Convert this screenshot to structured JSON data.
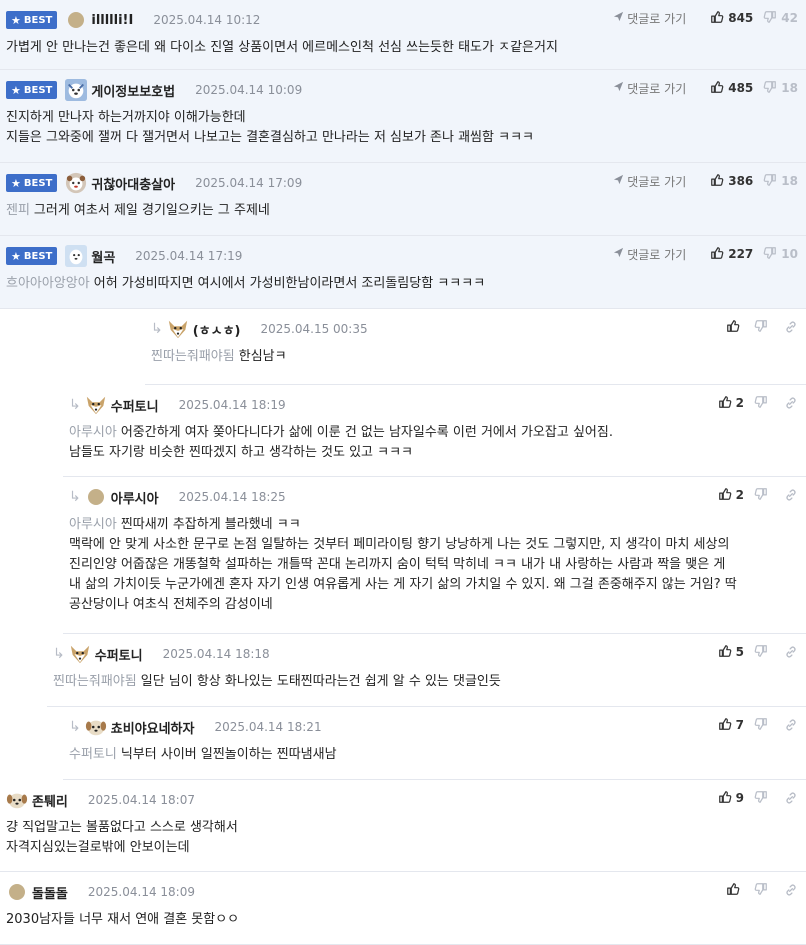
{
  "labels": {
    "best": "BEST",
    "reply_to": "댓글로 가기"
  },
  "colors": {
    "best_badge": "#3d6ec9",
    "best_bg": "#f1f5fb",
    "divider": "#e4e7ee",
    "muted": "#8a8f99"
  },
  "comments": [
    {
      "best": true,
      "avatar": "brown-circle",
      "author": "illllli!I",
      "date": "2025.04.14 10:12",
      "likes": "845",
      "dislikes": "42",
      "lines": [
        "가볍게 안 만나는건 좋은데 왜 다이소 진열 상품이면서 에르메스인척 선심 쓰는듯한 태도가 ㅈ같은거지"
      ]
    },
    {
      "best": true,
      "avatar": "blue-dog",
      "author": "게이정보보호법",
      "date": "2025.04.14 10:09",
      "likes": "485",
      "dislikes": "18",
      "lines": [
        "진지하게 만나자 하는거까지야 이해가능한데",
        "지들은 그와중에 잴꺼 다 잴거면서 나보고는 결혼결심하고 만나라는 저 심보가 존나 괘씸함 ㅋㅋㅋ"
      ]
    },
    {
      "best": true,
      "avatar": "red-dog",
      "author": "귀찮아대충살아",
      "date": "2025.04.14 17:09",
      "likes": "386",
      "dislikes": "18",
      "mention": "젠피",
      "lines": [
        "그러게 여초서 제일 경기일으키는 그 주제네"
      ]
    },
    {
      "best": true,
      "avatar": "white-dog",
      "author": "월곡",
      "date": "2025.04.14 17:19",
      "likes": "227",
      "dislikes": "10",
      "mention": "흐아아아앙앙아",
      "lines": [
        "어허 가성비따지면 여시에서 가성비한남이라면서 조리돌림당함 ㅋㅋㅋㅋ"
      ]
    },
    {
      "best": false,
      "avatar": "fox",
      "author": "(ㅎㅅㅎ)",
      "date": "2025.04.15 00:35",
      "likes": "",
      "dislikes": "",
      "mention": "찐따는줘패야됨",
      "lines": [
        "한심남ㅋ"
      ]
    },
    {
      "best": false,
      "avatar": "fox",
      "author": "수퍼토니",
      "date": "2025.04.14 18:19",
      "likes": "2",
      "dislikes": "",
      "mention": "아루시아",
      "lines": [
        "어중간하게 여자 쫒아다니다가 삶에 이룬 건 없는 남자일수록 이런 거에서 가오잡고 싶어짐.",
        "남들도 자기랑 비슷한 찐따겠지 하고 생각하는 것도 있고 ㅋㅋㅋ"
      ]
    },
    {
      "best": false,
      "avatar": "brown-circle",
      "author": "아루시아",
      "date": "2025.04.14 18:25",
      "likes": "2",
      "dislikes": "",
      "mention": "아루시아",
      "lines": [
        "찐따새끼 추잡하게 블라했네 ㅋㅋ",
        "맥락에 안 맞게 사소한 문구로 논점 일탈하는 것부터 페미라이팅 향기 낭낭하게 나는 것도 그렇지만, 지 생각이 마치 세상의",
        "진리인양 어줍잖은 개똥철학 설파하는 개틀딱 꼰대 논리까지 숨이 턱턱 막히네 ㅋㅋ 내가 내 사랑하는 사람과 짝을 맺은 게",
        "내 삶의 가치이듯 누군가에겐 혼자 자기 인생 여유롭게 사는 게 자기 삶의 가치일 수 있지. 왜 그걸 존중해주지 않는 거임? 딱",
        "공산당이나 여초식 전체주의 감성이네"
      ]
    },
    {
      "best": false,
      "avatar": "fox",
      "author": "수퍼토니",
      "date": "2025.04.14 18:18",
      "likes": "5",
      "dislikes": "",
      "mention": "찐따는줘패야됨",
      "lines": [
        "일단 님이 항상 화나있는 도태찐따라는건 쉽게 알 수 있는 댓글인듯"
      ]
    },
    {
      "best": false,
      "avatar": "puppy",
      "author": "쵸비야요네하자",
      "date": "2025.04.14 18:21",
      "likes": "7",
      "dislikes": "",
      "mention": "수퍼토니",
      "lines": [
        "닉부터 사이버 일찐놀이하는 찐따냄새남"
      ]
    },
    {
      "best": false,
      "avatar": "puppy",
      "author": "존퉤리",
      "date": "2025.04.14 18:07",
      "likes": "9",
      "dislikes": "",
      "lines": [
        "걍 직업말고는 볼품없다고 스스로 생각해서",
        "자격지심있는걸로밖에 안보이는데"
      ]
    },
    {
      "best": false,
      "avatar": "brown-circle",
      "author": "돌돌돌",
      "date": "2025.04.14 18:09",
      "likes": "",
      "dislikes": "",
      "lines": [
        "2030남자들 너무 재서 연애 결혼 못함ㅇㅇ"
      ]
    }
  ]
}
